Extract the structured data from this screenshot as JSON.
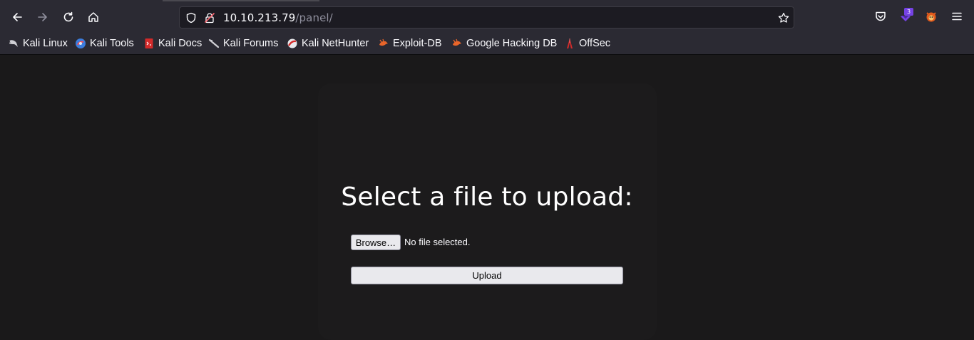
{
  "browser": {
    "url_host": "10.10.213.79",
    "url_path": "/panel/",
    "extension_badge": "3"
  },
  "bookmarks": [
    {
      "label": "Kali Linux",
      "icon": "kali-dragon-icon"
    },
    {
      "label": "Kali Tools",
      "icon": "kali-tools-icon"
    },
    {
      "label": "Kali Docs",
      "icon": "kali-docs-icon"
    },
    {
      "label": "Kali Forums",
      "icon": "kali-forums-icon"
    },
    {
      "label": "Kali NetHunter",
      "icon": "nethunter-icon"
    },
    {
      "label": "Exploit-DB",
      "icon": "exploit-db-icon"
    },
    {
      "label": "Google Hacking DB",
      "icon": "ghdb-icon"
    },
    {
      "label": "OffSec",
      "icon": "offsec-icon"
    }
  ],
  "page": {
    "heading": "Select a file to upload:",
    "browse_label": "Browse…",
    "file_status": "No file selected.",
    "upload_label": "Upload"
  },
  "colors": {
    "toolbar": "#2b2a33",
    "page_background": "#1a191a",
    "button_face": "#e9e9ed"
  }
}
